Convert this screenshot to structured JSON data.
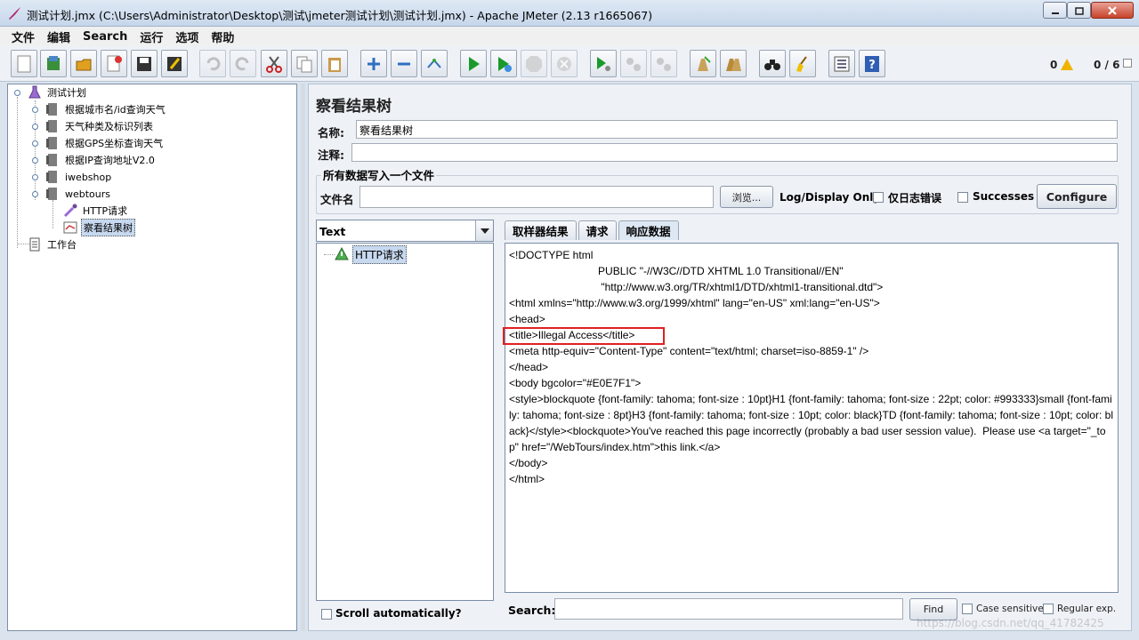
{
  "window": {
    "title": "测试计划.jmx (C:\\Users\\Administrator\\Desktop\\测试\\jmeter测试计划\\测试计划.jmx) - Apache JMeter (2.13 r1665067)"
  },
  "menu": [
    "文件",
    "编辑",
    "Search",
    "运行",
    "选项",
    "帮助"
  ],
  "toolbar": {
    "icons": [
      "new-icon",
      "templates-icon",
      "open-icon",
      "close-icon",
      "save-icon",
      "save-as-icon",
      "undo-icon",
      "redo-icon",
      "cut-icon",
      "copy-icon",
      "paste-icon",
      "expand-icon",
      "collapse-icon",
      "toggle-icon",
      "start-icon",
      "start-no-pause-icon",
      "stop-icon",
      "shutdown-icon",
      "remote-start-icon",
      "remote-stop-icon",
      "remote-exit-icon",
      "clear-icon",
      "clear-all-icon",
      "search-icon",
      "reset-search-icon",
      "function-helper-icon",
      "help-icon"
    ],
    "error_count": "0",
    "threads": "0 / 6"
  },
  "tree": {
    "root": "测试计划",
    "groups": [
      "根据城市名/id查询天气",
      "天气种类及标识列表",
      "根据GPS坐标查询天气",
      "根据IP查询地址V2.0",
      "iwebshop",
      "webtours"
    ],
    "children": [
      "HTTP请求",
      "察看结果树"
    ],
    "workbench": "工作台"
  },
  "panel": {
    "title": "察看结果树",
    "name_label": "名称:",
    "name_value": "察看结果树",
    "comment_label": "注释:",
    "comment_value": "",
    "file_group_title": "所有数据写入一个文件",
    "filename_label": "文件名",
    "filename_value": "",
    "browse_button": "浏览...",
    "log_display_label": "Log/Display Only:",
    "errors_label": "仅日志错误",
    "successes_label": "Successes",
    "configure_button": "Configure"
  },
  "results": {
    "renderer": "Text",
    "sample": "HTTP请求",
    "scroll_label": "Scroll automatically?",
    "tabs": [
      "取样器结果",
      "请求",
      "响应数据"
    ],
    "active_tab": 2,
    "response_lines": [
      "<!DOCTYPE html",
      "                              PUBLIC \"-//W3C//DTD XHTML 1.0 Transitional//EN\"",
      "                               \"http://www.w3.org/TR/xhtml1/DTD/xhtml1-transitional.dtd\">",
      "<html xmlns=\"http://www.w3.org/1999/xhtml\" lang=\"en-US\" xml:lang=\"en-US\">",
      "<head>",
      "<title>Illegal Access</title>",
      "<meta http-equiv=\"Content-Type\" content=\"text/html; charset=iso-8859-1\" />",
      "</head>",
      "<body bgcolor=\"#E0E7F1\">",
      "<style>blockquote {font-family: tahoma; font-size : 10pt}H1 {font-family: tahoma; font-size : 22pt; color: #993333}small {font-family: tahoma; font-size : 8pt}H3 {font-family: tahoma; font-size : 10pt; color: black}TD {font-family: tahoma; font-size : 10pt; color: black}</style><blockquote>You've reached this page incorrectly (probably a bad user session value).  Please use <a target=\"_top\" href=\"/WebTours/index.htm\">this link.</a>",
      "</body>",
      "</html>"
    ],
    "search_label": "Search:",
    "search_value": "",
    "find_button": "Find",
    "case_label": "Case sensitive",
    "regex_label": "Regular exp."
  },
  "watermark": "https://blog.csdn.net/qq_41782425",
  "colors": {
    "accent": "#c7d9ef",
    "highlight_box": "#e02020",
    "start_green": "#1a9a2a"
  }
}
